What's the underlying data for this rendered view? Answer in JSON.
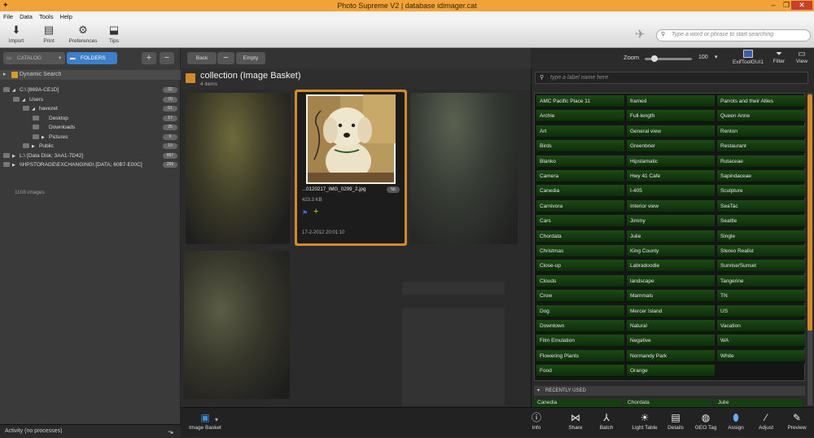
{
  "window": {
    "title": "Photo Supreme V2 | database idimager.cat",
    "min": "–",
    "max": "❐",
    "close": "✕"
  },
  "menu": [
    "File",
    "Data",
    "Tools",
    "Help"
  ],
  "toolbar": {
    "import": "Import",
    "print": "Print",
    "preferences": "Preferences",
    "tips": "Tips",
    "search_placeholder": "Type a word or phrase to start searching"
  },
  "left": {
    "catalog_tab": "CATALOG",
    "folders_tab": "FOLDERS",
    "add": "+",
    "remove": "−",
    "dynamic_search": "Dynamic Search",
    "tree": [
      {
        "label": "C:\\  [869A-CE1D]",
        "indent": 0,
        "arrow": "◢",
        "count": "32"
      },
      {
        "label": "Users",
        "indent": 1,
        "arrow": "◢",
        "count": "70"
      },
      {
        "label": "havezet",
        "indent": 2,
        "arrow": "◢",
        "count": "51"
      },
      {
        "label": "Desktop",
        "indent": 3,
        "arrow": "",
        "count": "17"
      },
      {
        "label": "Downloads",
        "indent": 3,
        "arrow": "",
        "count": "25"
      },
      {
        "label": "Pictures",
        "indent": 3,
        "arrow": "▶",
        "count": "9"
      },
      {
        "label": "Public",
        "indent": 2,
        "arrow": "▶",
        "count": "19"
      },
      {
        "label": "L:\\  [Data Disk; 3AA1-7D42]",
        "indent": 0,
        "arrow": "▶",
        "count": "857"
      },
      {
        "label": "\\\\HPSTORAGE\\EXCHANGING\\  [DATA; 60B7-E00C]",
        "indent": 0,
        "arrow": "▶",
        "count": "209"
      }
    ],
    "image_count": "1108 images",
    "status": "Activity (no processes)"
  },
  "center": {
    "back": "Back",
    "minus": "−",
    "empty": "Empty",
    "collection_title": "collection (Image Basket)",
    "item_count": "4 items",
    "selected": {
      "filename": "...0120217_IMG_0299_2.jpg",
      "badge": "5b",
      "size": "423.3 KB",
      "date": "17-2-2012 20:01:10",
      "add": "+"
    }
  },
  "right_tools": {
    "zoom_label": "Zoom",
    "zoom_value": "100",
    "exif": "ExifToolGUI1",
    "filter": "Filter",
    "view": "View"
  },
  "labels": {
    "search_placeholder": "type a label name here",
    "col1": [
      "AMC Pacific Place 11",
      "Archie",
      "Art",
      "Birds",
      "Blanko",
      "Camera",
      "Canedia",
      "Carnivora",
      "Cars",
      "Chordata",
      "Christmas",
      "Close-up",
      "Clouds",
      "Crow",
      "Dog",
      "Downtown",
      "Film Emulation",
      "Flowering Plants",
      "Food"
    ],
    "col2": [
      "framed",
      "Full-length",
      "General view",
      "Greenbrier",
      "Hipstamatic",
      "Hwy 41 Cafe",
      "I-405",
      "Interior view",
      "Jimmy",
      "Julie",
      "King County",
      "Labradoodle",
      "landscape",
      "Mammals",
      "Mercer Island",
      "Natural",
      "Negative",
      "Normandy Park",
      "Orange"
    ],
    "col3": [
      "Parrots and their Allies",
      "Queen Anne",
      "Renton",
      "Restaurant",
      "Rutaceae",
      "Sapindaceae",
      "Sculpture",
      "SeaTac",
      "Seattle",
      "Single",
      "Stereo Realist",
      "Sunrise/Sunset",
      "Tangerine",
      "TN",
      "US",
      "Vacation",
      "WA",
      "White"
    ],
    "recently_used": "RECENTLY USED",
    "recent": [
      "Canedia",
      "Chordata",
      "Julie"
    ]
  },
  "bottom": {
    "basket": "Image Basket",
    "tools": [
      "Info",
      "Share",
      "Batch",
      "Light Table",
      "Details",
      "GEO Tag",
      "Assign",
      "Adjust",
      "Preview"
    ]
  }
}
